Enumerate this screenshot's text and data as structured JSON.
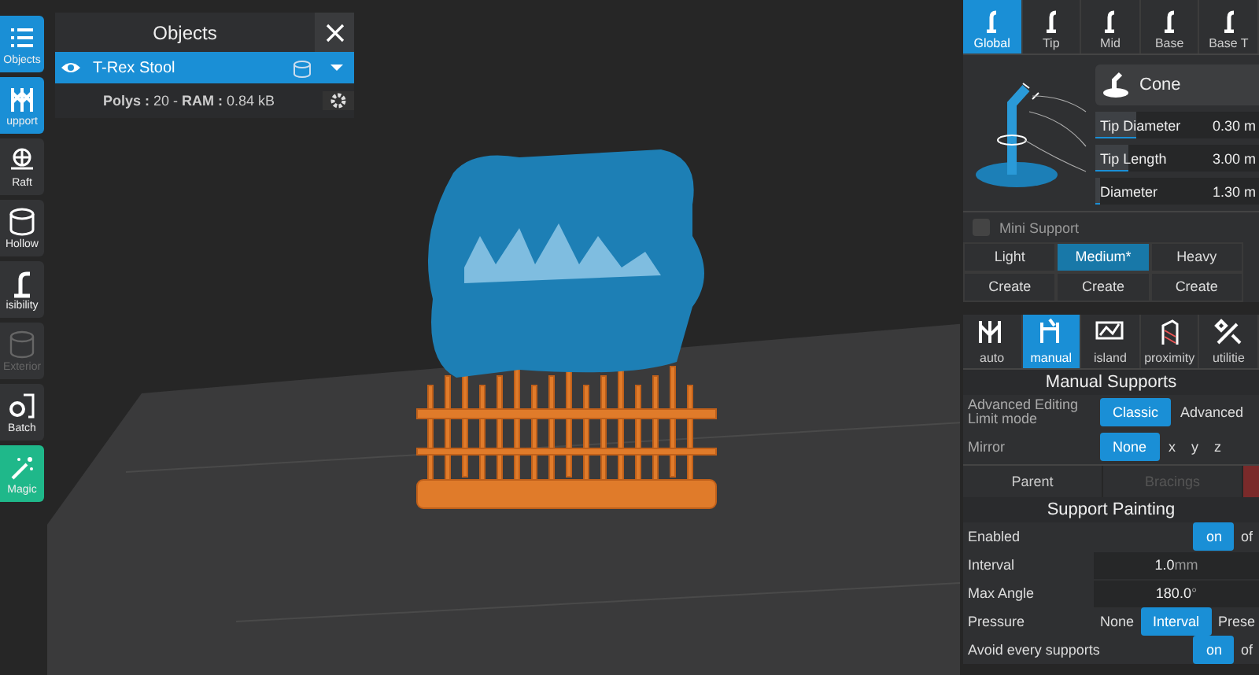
{
  "toolbar": [
    {
      "kind": "objects",
      "label": "Objects",
      "selected": true,
      "disabled": false
    },
    {
      "kind": "support",
      "label": "upport",
      "selected": true,
      "disabled": false
    },
    {
      "kind": "raft",
      "label": "Raft",
      "selected": false,
      "disabled": false
    },
    {
      "kind": "hollow",
      "label": "Hollow",
      "selected": false,
      "disabled": false
    },
    {
      "kind": "visibility",
      "label": "isibility",
      "selected": false,
      "disabled": false
    },
    {
      "kind": "exterior",
      "label": "Exterior",
      "selected": false,
      "disabled": true
    },
    {
      "kind": "batch",
      "label": "Batch",
      "selected": false,
      "disabled": false
    },
    {
      "kind": "magic",
      "label": "Magic",
      "selected": true,
      "disabled": false
    }
  ],
  "objects_panel": {
    "title": "Objects",
    "object": {
      "name": "T-Rex Stool",
      "visible": true,
      "selected": true
    },
    "stats": "**Polys :** 20 - **RAM :** 0.84 kB"
  },
  "right_panel": {
    "tip_tabs": [
      {
        "label": "Global",
        "selected": true
      },
      {
        "label": "Tip",
        "selected": false
      },
      {
        "label": "Mid",
        "selected": false
      },
      {
        "label": "Base",
        "selected": false
      },
      {
        "label": "Base T",
        "selected": false
      }
    ],
    "shape": "Cone",
    "params": [
      {
        "label": "Tip Diameter",
        "value": "0.30 m",
        "level": 0.25
      },
      {
        "label": "Tip Length",
        "value": "3.00 m",
        "level": 0.2
      },
      {
        "label": "Diameter",
        "value": "1.30 m",
        "level": 0.03
      }
    ],
    "mini_support": {
      "label": "Mini Support",
      "checked": false
    },
    "density": [
      {
        "label": "Light",
        "selected": false
      },
      {
        "label": "Medium*",
        "selected": true
      },
      {
        "label": "Heavy",
        "selected": false
      }
    ],
    "create_buttons": [
      "Create",
      "Create",
      "Create"
    ],
    "mode_tabs": [
      {
        "kind": "auto",
        "label": "auto",
        "selected": false
      },
      {
        "kind": "manual",
        "label": "manual",
        "selected": true
      },
      {
        "kind": "island",
        "label": "island",
        "selected": false
      },
      {
        "kind": "proximity",
        "label": "proximity",
        "selected": false
      },
      {
        "kind": "utilities",
        "label": "utilitie",
        "selected": false
      }
    ],
    "manual_supports": {
      "title": "Manual Supports",
      "rows": [
        {
          "label": "Advanced Editing Limit mode",
          "options": [
            {
              "label": "Classic",
              "selected": true
            },
            {
              "label": "Advanced",
              "selected": false
            }
          ]
        },
        {
          "label": "Mirror",
          "options": [
            {
              "label": "None",
              "selected": true
            },
            {
              "label": "x",
              "selected": false
            },
            {
              "label": "y",
              "selected": false
            },
            {
              "label": "z",
              "selected": false
            }
          ]
        }
      ],
      "actions": [
        {
          "label": "Parent",
          "disabled": false
        },
        {
          "label": "Bracings",
          "disabled": true
        }
      ]
    },
    "support_painting": {
      "title": "Support Painting",
      "rows": [
        {
          "kind": "toggle",
          "label": "Enabled",
          "options": [
            {
              "label": "on",
              "selected": true
            },
            {
              "label": "of",
              "selected": false
            }
          ]
        },
        {
          "kind": "number",
          "label": "Interval",
          "value": "1.0",
          "unit": "mm"
        },
        {
          "kind": "number",
          "label": "Max Angle",
          "value": "180.0",
          "unit": "°"
        },
        {
          "kind": "toggle",
          "label": "Pressure",
          "options": [
            {
              "label": "None",
              "selected": false
            },
            {
              "label": "Interval",
              "selected": true
            },
            {
              "label": "Prese",
              "selected": false
            }
          ]
        },
        {
          "kind": "toggle",
          "label": "Avoid every supports",
          "options": [
            {
              "label": "on",
              "selected": true
            },
            {
              "label": "of",
              "selected": false
            }
          ]
        }
      ]
    }
  }
}
